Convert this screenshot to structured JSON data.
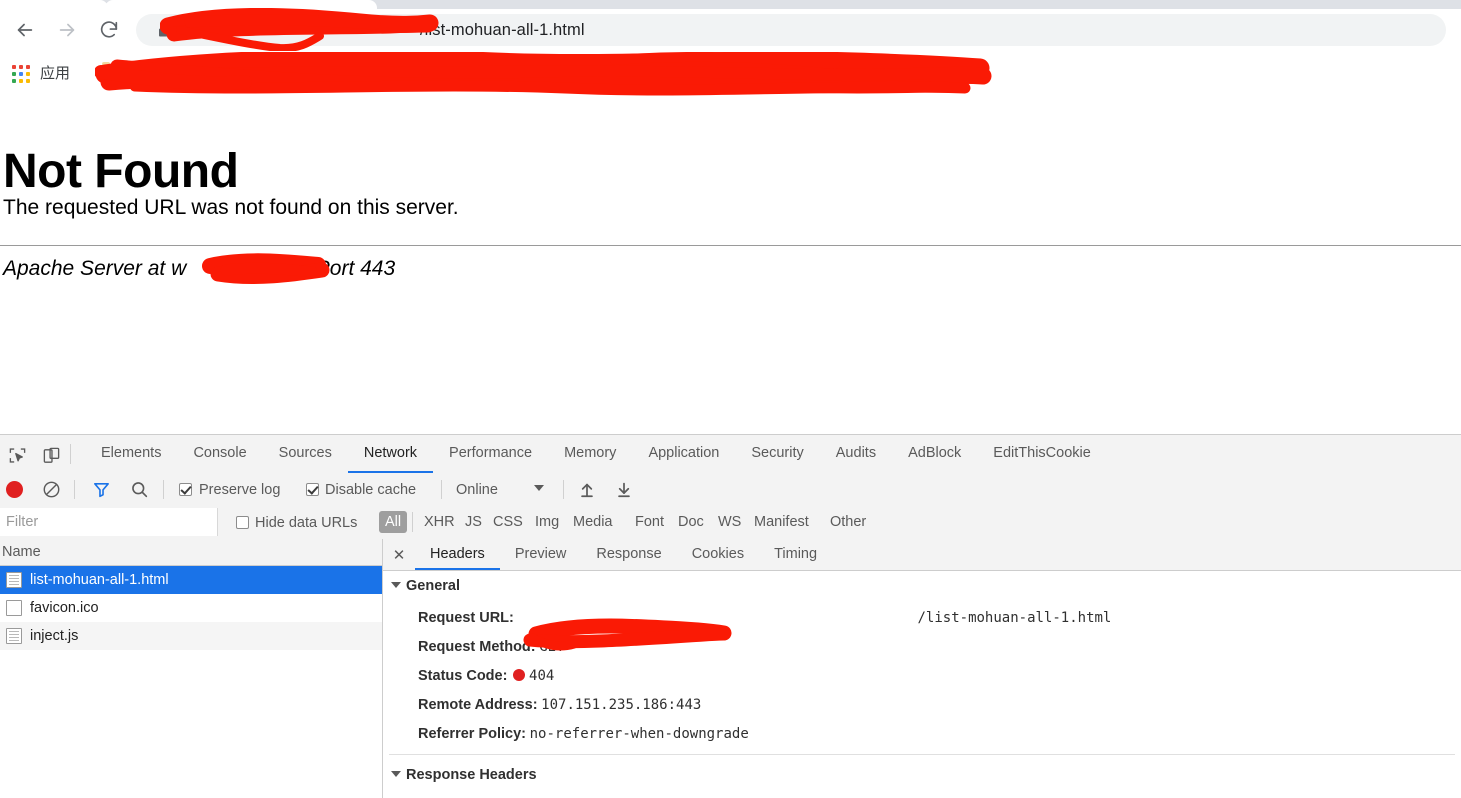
{
  "browser": {
    "nav": {
      "back_title": "Back",
      "forward_title": "Forward",
      "reload_title": "Reload"
    },
    "omnibox": {
      "lock_icon": "lock-icon",
      "url_visible_suffix": "/list-mohuan-all-1.html",
      "redacted": true
    },
    "bookmarks": {
      "apps_icon": "apps-grid-icon",
      "apps_label": "应用",
      "redacted": true
    }
  },
  "page": {
    "heading": "Not Found",
    "message": "The requested URL was not found on this server.",
    "server_line_prefix": "Apache Server at w",
    "server_line_suffix": "com Port 443"
  },
  "devtools": {
    "toolbar_icons": {
      "inspect": "inspect-element-icon",
      "device": "device-toolbar-icon"
    },
    "tabs": [
      {
        "label": "Elements",
        "active": false
      },
      {
        "label": "Console",
        "active": false
      },
      {
        "label": "Sources",
        "active": false
      },
      {
        "label": "Network",
        "active": true
      },
      {
        "label": "Performance",
        "active": false
      },
      {
        "label": "Memory",
        "active": false
      },
      {
        "label": "Application",
        "active": false
      },
      {
        "label": "Security",
        "active": false
      },
      {
        "label": "Audits",
        "active": false
      },
      {
        "label": "AdBlock",
        "active": false
      },
      {
        "label": "EditThisCookie",
        "active": false
      }
    ],
    "network_toolbar": {
      "record_icon": "record-icon",
      "clear_icon": "clear-icon",
      "filter_icon": "filter-funnel-icon",
      "search_icon": "search-icon",
      "preserve_log_label": "Preserve log",
      "preserve_log_checked": true,
      "disable_cache_label": "Disable cache",
      "disable_cache_checked": true,
      "throttling_value": "Online",
      "import_icon": "import-har-icon",
      "export_icon": "export-har-icon"
    },
    "filter_bar": {
      "filter_placeholder": "Filter",
      "hide_data_urls_label": "Hide data URLs",
      "hide_data_urls_checked": false,
      "types": [
        "All",
        "XHR",
        "JS",
        "CSS",
        "Img",
        "Media",
        "Font",
        "Doc",
        "WS",
        "Manifest",
        "Other"
      ],
      "selected_type": "All"
    },
    "requests": {
      "column_header": "Name",
      "rows": [
        {
          "name": "list-mohuan-all-1.html",
          "selected": true,
          "icon": "document-icon"
        },
        {
          "name": "favicon.ico",
          "selected": false,
          "icon": "blank-document-icon"
        },
        {
          "name": "inject.js",
          "selected": false,
          "icon": "script-icon"
        }
      ]
    },
    "detail": {
      "close_icon": "close-icon",
      "tabs": [
        {
          "label": "Headers",
          "active": true
        },
        {
          "label": "Preview",
          "active": false
        },
        {
          "label": "Response",
          "active": false
        },
        {
          "label": "Cookies",
          "active": false
        },
        {
          "label": "Timing",
          "active": false
        }
      ],
      "general_title": "General",
      "fields": [
        {
          "key": "Request URL:",
          "value": "/list-mohuan-all-1.html",
          "redacted": true
        },
        {
          "key": "Request Method:",
          "value": "GET",
          "redacted": false
        },
        {
          "key": "Status Code:",
          "value": "404",
          "status_dot": true,
          "redacted": false
        },
        {
          "key": "Remote Address:",
          "value": "107.151.235.186:443",
          "redacted": false
        },
        {
          "key": "Referrer Policy:",
          "value": "no-referrer-when-downgrade",
          "redacted": false
        }
      ],
      "response_headers_title": "Response Headers"
    }
  },
  "colors": {
    "accent_blue": "#1a73e8",
    "redaction_red": "#fa1a05",
    "status_red": "#e02020",
    "devtools_bg": "#f3f3f3"
  }
}
